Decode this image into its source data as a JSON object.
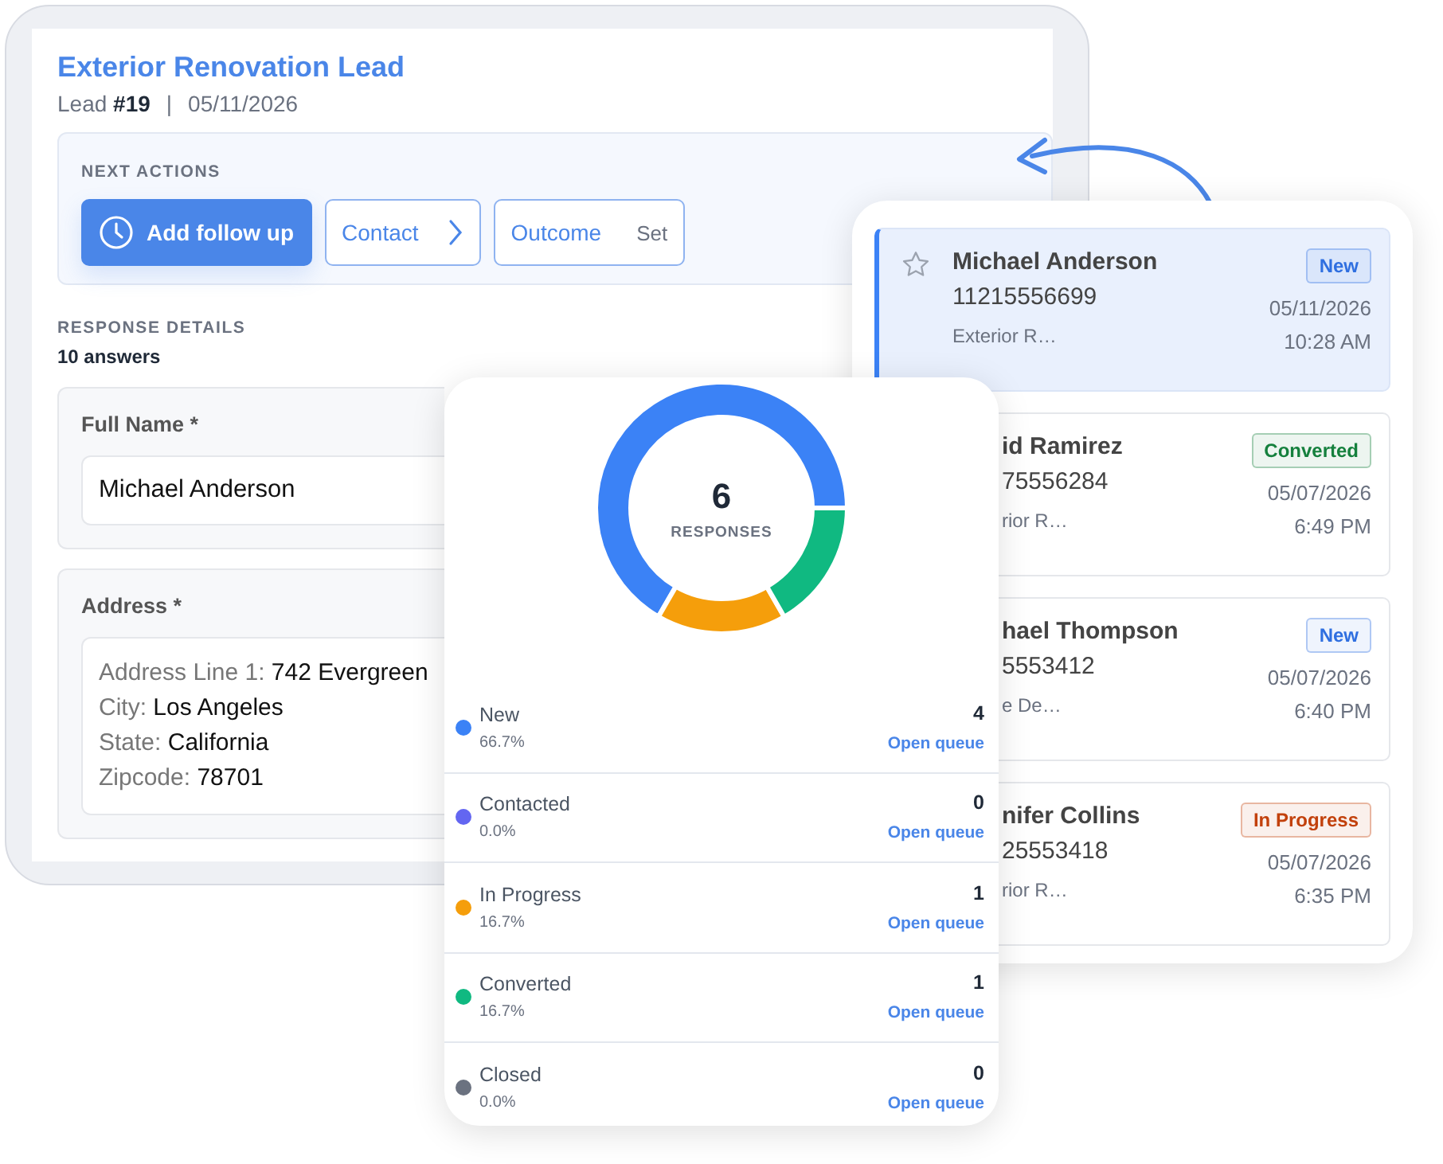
{
  "lead_detail": {
    "title": "Exterior Renovation Lead",
    "lead_label": "Lead **#19**",
    "separator": "|",
    "date": "05/11/2026",
    "next_actions": {
      "heading": "NEXT ACTIONS",
      "buttons": [
        {
          "kind": "primary",
          "label": "Add follow up"
        },
        {
          "kind": "chevron",
          "label": "Contact"
        },
        {
          "kind": "split",
          "label": "Outcome",
          "secondary": "Set"
        }
      ]
    },
    "response_heading": "RESPONSE DETAILS",
    "answer_count": "10 answers",
    "fields": [
      {
        "kind": "single",
        "label": "Full Name *",
        "value": "Michael Anderson"
      },
      {
        "kind": "multi",
        "label": "Address *",
        "lines": [
          {
            "label": "Address Line 1:",
            "value": "742 Evergreen"
          },
          {
            "label": "City:",
            "value": "Los Angeles"
          },
          {
            "label": "State:",
            "value": "California"
          },
          {
            "label": "Zipcode:",
            "value": "78701"
          }
        ]
      }
    ]
  },
  "status_summary": {
    "total": "6",
    "total_label": "RESPONSES",
    "chart_data": {
      "type": "donut",
      "categories": [
        "New",
        "Contacted",
        "In Progress",
        "Converted",
        "Closed"
      ],
      "values": [
        66.7,
        0,
        16.7,
        16.7,
        0
      ]
    },
    "legend": [
      {
        "percent": "66.7%",
        "count": "4",
        "link": "Open queue",
        "color": "#3b82f6"
      },
      {
        "percent": "0.0%",
        "count": "0",
        "link": "Open queue",
        "color": "#6366f1"
      },
      {
        "percent": "16.7%",
        "count": "1",
        "link": "Open queue",
        "color": "#f59e0b"
      },
      {
        "percent": "16.7%",
        "count": "1",
        "link": "Open queue",
        "color": "#10b981"
      },
      {
        "percent": "0.0%",
        "count": "0",
        "link": "Open queue",
        "color": "#6b7280"
      }
    ]
  },
  "lead_list": [
    {
      "selected": true,
      "starred": false,
      "name": "Michael Anderson",
      "phone": "11215556699",
      "description": "Exterior R…",
      "status": "New",
      "color": "#2f6fe0",
      "date": "05/11/2026",
      "time": "10:28 AM"
    },
    {
      "selected": false,
      "name": "id Ramirez",
      "phone": "75556284",
      "description": "rior R…",
      "status": "Converted",
      "color": "#15803d",
      "date": "05/07/2026",
      "time": "6:49 PM"
    },
    {
      "selected": false,
      "name": "hael Thompson",
      "phone": "5553412",
      "description": "e De…",
      "status": "New",
      "color": "#2f6fe0",
      "date": "05/07/2026",
      "time": "6:40 PM"
    },
    {
      "selected": false,
      "name": "nifer Collins",
      "phone": "25553418",
      "description": "rior R…",
      "status": "In Progress",
      "color": "#c2410c",
      "date": "05/07/2026",
      "time": "6:35 PM"
    }
  ]
}
